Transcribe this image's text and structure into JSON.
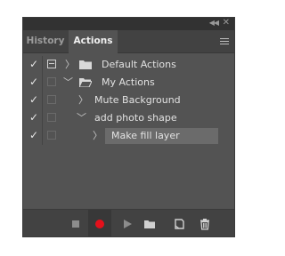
{
  "tabs": [
    {
      "label": "History",
      "active": false
    },
    {
      "label": "Actions",
      "active": true
    }
  ],
  "actions": [
    {
      "label": "Default Actions",
      "level": 0,
      "type": "set",
      "expanded": false,
      "checked": true,
      "dialog": true
    },
    {
      "label": "My Actions",
      "level": 0,
      "type": "set",
      "expanded": true,
      "checked": true,
      "dialog": false
    },
    {
      "label": "Mute Background",
      "level": 1,
      "type": "action",
      "expanded": false,
      "checked": true,
      "dialog": false
    },
    {
      "label": "add photo shape",
      "level": 1,
      "type": "action",
      "expanded": true,
      "checked": true,
      "dialog": false
    },
    {
      "label": "Make fill layer",
      "level": 2,
      "type": "command",
      "expanded": false,
      "checked": true,
      "dialog": false,
      "selected": true
    }
  ],
  "footer_buttons": [
    "stop-icon",
    "record-icon",
    "play-icon",
    "folder-icon",
    "new-action-icon",
    "trash-icon"
  ],
  "colors": {
    "panel": "#535353",
    "record": "#e4101b",
    "selected_row": "#6b6b6b"
  }
}
